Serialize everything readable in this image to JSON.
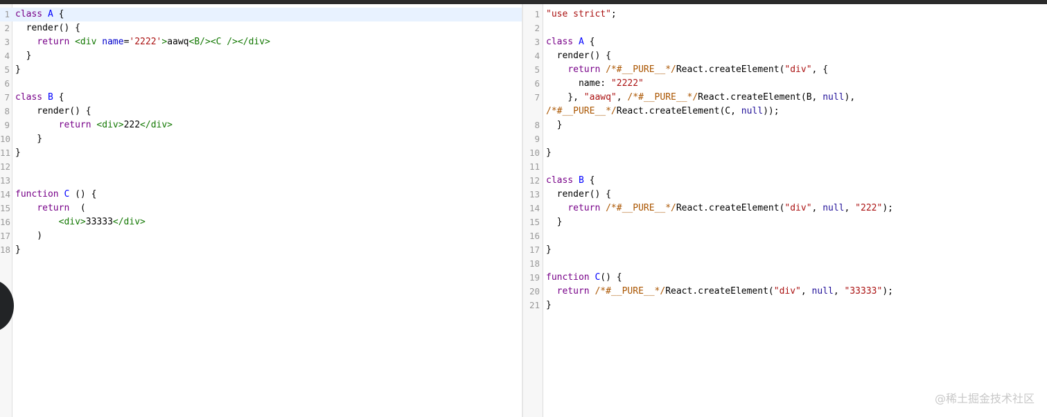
{
  "left_pane": {
    "lines": [
      {
        "n": "1",
        "active": true,
        "tokens": [
          {
            "t": "class",
            "c": "kw"
          },
          {
            "t": " "
          },
          {
            "t": "A",
            "c": "def"
          },
          {
            "t": " {"
          }
        ]
      },
      {
        "n": "2",
        "tokens": [
          {
            "t": "  render() {"
          }
        ]
      },
      {
        "n": "3",
        "tokens": [
          {
            "t": "    "
          },
          {
            "t": "return",
            "c": "kw"
          },
          {
            "t": " "
          },
          {
            "t": "<div",
            "c": "tag"
          },
          {
            "t": " "
          },
          {
            "t": "name",
            "c": "attr"
          },
          {
            "t": "="
          },
          {
            "t": "'2222'",
            "c": "str"
          },
          {
            "t": ">",
            "c": "tag"
          },
          {
            "t": "aawq"
          },
          {
            "t": "<B/>",
            "c": "tag"
          },
          {
            "t": "<C />",
            "c": "tag"
          },
          {
            "t": "</div>",
            "c": "tag"
          }
        ]
      },
      {
        "n": "4",
        "tokens": [
          {
            "t": "  }"
          }
        ]
      },
      {
        "n": "5",
        "tokens": [
          {
            "t": "}"
          }
        ]
      },
      {
        "n": "6",
        "tokens": []
      },
      {
        "n": "7",
        "tokens": [
          {
            "t": "class",
            "c": "kw"
          },
          {
            "t": " "
          },
          {
            "t": "B",
            "c": "def"
          },
          {
            "t": " {"
          }
        ]
      },
      {
        "n": "8",
        "tokens": [
          {
            "t": "    render() {"
          }
        ]
      },
      {
        "n": "9",
        "tokens": [
          {
            "t": "        "
          },
          {
            "t": "return",
            "c": "kw"
          },
          {
            "t": " "
          },
          {
            "t": "<div>",
            "c": "tag"
          },
          {
            "t": "222"
          },
          {
            "t": "</div>",
            "c": "tag"
          }
        ]
      },
      {
        "n": "10",
        "tokens": [
          {
            "t": "    }"
          }
        ]
      },
      {
        "n": "11",
        "tokens": [
          {
            "t": "}"
          }
        ]
      },
      {
        "n": "12",
        "tokens": []
      },
      {
        "n": "13",
        "tokens": []
      },
      {
        "n": "14",
        "tokens": [
          {
            "t": "function",
            "c": "kw"
          },
          {
            "t": " "
          },
          {
            "t": "C",
            "c": "def"
          },
          {
            "t": " () {"
          }
        ]
      },
      {
        "n": "15",
        "tokens": [
          {
            "t": "    "
          },
          {
            "t": "return",
            "c": "kw"
          },
          {
            "t": "  ("
          }
        ]
      },
      {
        "n": "16",
        "tokens": [
          {
            "t": "        "
          },
          {
            "t": "<div>",
            "c": "tag"
          },
          {
            "t": "33333"
          },
          {
            "t": "</div>",
            "c": "tag"
          }
        ]
      },
      {
        "n": "17",
        "tokens": [
          {
            "t": "    )"
          }
        ]
      },
      {
        "n": "18",
        "tokens": [
          {
            "t": "}"
          }
        ]
      }
    ]
  },
  "right_pane": {
    "lines": [
      {
        "n": "1",
        "tokens": [
          {
            "t": "\"use strict\"",
            "c": "str"
          },
          {
            "t": ";"
          }
        ]
      },
      {
        "n": "2",
        "tokens": []
      },
      {
        "n": "3",
        "tokens": [
          {
            "t": "class",
            "c": "kw"
          },
          {
            "t": " "
          },
          {
            "t": "A",
            "c": "def"
          },
          {
            "t": " {"
          }
        ]
      },
      {
        "n": "4",
        "tokens": [
          {
            "t": "  render() {"
          }
        ]
      },
      {
        "n": "5",
        "tokens": [
          {
            "t": "    "
          },
          {
            "t": "return",
            "c": "kw"
          },
          {
            "t": " "
          },
          {
            "t": "/*#__PURE__*/",
            "c": "cmt"
          },
          {
            "t": "React.createElement("
          },
          {
            "t": "\"div\"",
            "c": "str"
          },
          {
            "t": ", {"
          }
        ]
      },
      {
        "n": "6",
        "tokens": [
          {
            "t": "      name: "
          },
          {
            "t": "\"2222\"",
            "c": "str"
          }
        ]
      },
      {
        "n": "7",
        "tokens": [
          {
            "t": "    }, "
          },
          {
            "t": "\"aawq\"",
            "c": "str"
          },
          {
            "t": ", "
          },
          {
            "t": "/*#__PURE__*/",
            "c": "cmt"
          },
          {
            "t": "React.createElement(B, "
          },
          {
            "t": "null",
            "c": "atom"
          },
          {
            "t": "),"
          }
        ]
      },
      {
        "n": "",
        "wrap": true,
        "tokens": [
          {
            "t": "/*#__PURE__*/",
            "c": "cmt"
          },
          {
            "t": "React.createElement(C, "
          },
          {
            "t": "null",
            "c": "atom"
          },
          {
            "t": "));"
          }
        ]
      },
      {
        "n": "8",
        "tokens": [
          {
            "t": "  }"
          }
        ]
      },
      {
        "n": "9",
        "tokens": []
      },
      {
        "n": "10",
        "tokens": [
          {
            "t": "}"
          }
        ]
      },
      {
        "n": "11",
        "tokens": []
      },
      {
        "n": "12",
        "tokens": [
          {
            "t": "class",
            "c": "kw"
          },
          {
            "t": " "
          },
          {
            "t": "B",
            "c": "def"
          },
          {
            "t": " {"
          }
        ]
      },
      {
        "n": "13",
        "tokens": [
          {
            "t": "  render() {"
          }
        ]
      },
      {
        "n": "14",
        "tokens": [
          {
            "t": "    "
          },
          {
            "t": "return",
            "c": "kw"
          },
          {
            "t": " "
          },
          {
            "t": "/*#__PURE__*/",
            "c": "cmt"
          },
          {
            "t": "React.createElement("
          },
          {
            "t": "\"div\"",
            "c": "str"
          },
          {
            "t": ", "
          },
          {
            "t": "null",
            "c": "atom"
          },
          {
            "t": ", "
          },
          {
            "t": "\"222\"",
            "c": "str"
          },
          {
            "t": ");"
          }
        ]
      },
      {
        "n": "15",
        "tokens": [
          {
            "t": "  }"
          }
        ]
      },
      {
        "n": "16",
        "tokens": []
      },
      {
        "n": "17",
        "tokens": [
          {
            "t": "}"
          }
        ]
      },
      {
        "n": "18",
        "tokens": []
      },
      {
        "n": "19",
        "tokens": [
          {
            "t": "function",
            "c": "kw"
          },
          {
            "t": " "
          },
          {
            "t": "C",
            "c": "def"
          },
          {
            "t": "() {"
          }
        ]
      },
      {
        "n": "20",
        "tokens": [
          {
            "t": "  "
          },
          {
            "t": "return",
            "c": "kw"
          },
          {
            "t": " "
          },
          {
            "t": "/*#__PURE__*/",
            "c": "cmt"
          },
          {
            "t": "React.createElement("
          },
          {
            "t": "\"div\"",
            "c": "str"
          },
          {
            "t": ", "
          },
          {
            "t": "null",
            "c": "atom"
          },
          {
            "t": ", "
          },
          {
            "t": "\"33333\"",
            "c": "str"
          },
          {
            "t": ");"
          }
        ]
      },
      {
        "n": "21",
        "tokens": [
          {
            "t": "}"
          }
        ]
      }
    ]
  },
  "watermark": "@稀土掘金技术社区"
}
